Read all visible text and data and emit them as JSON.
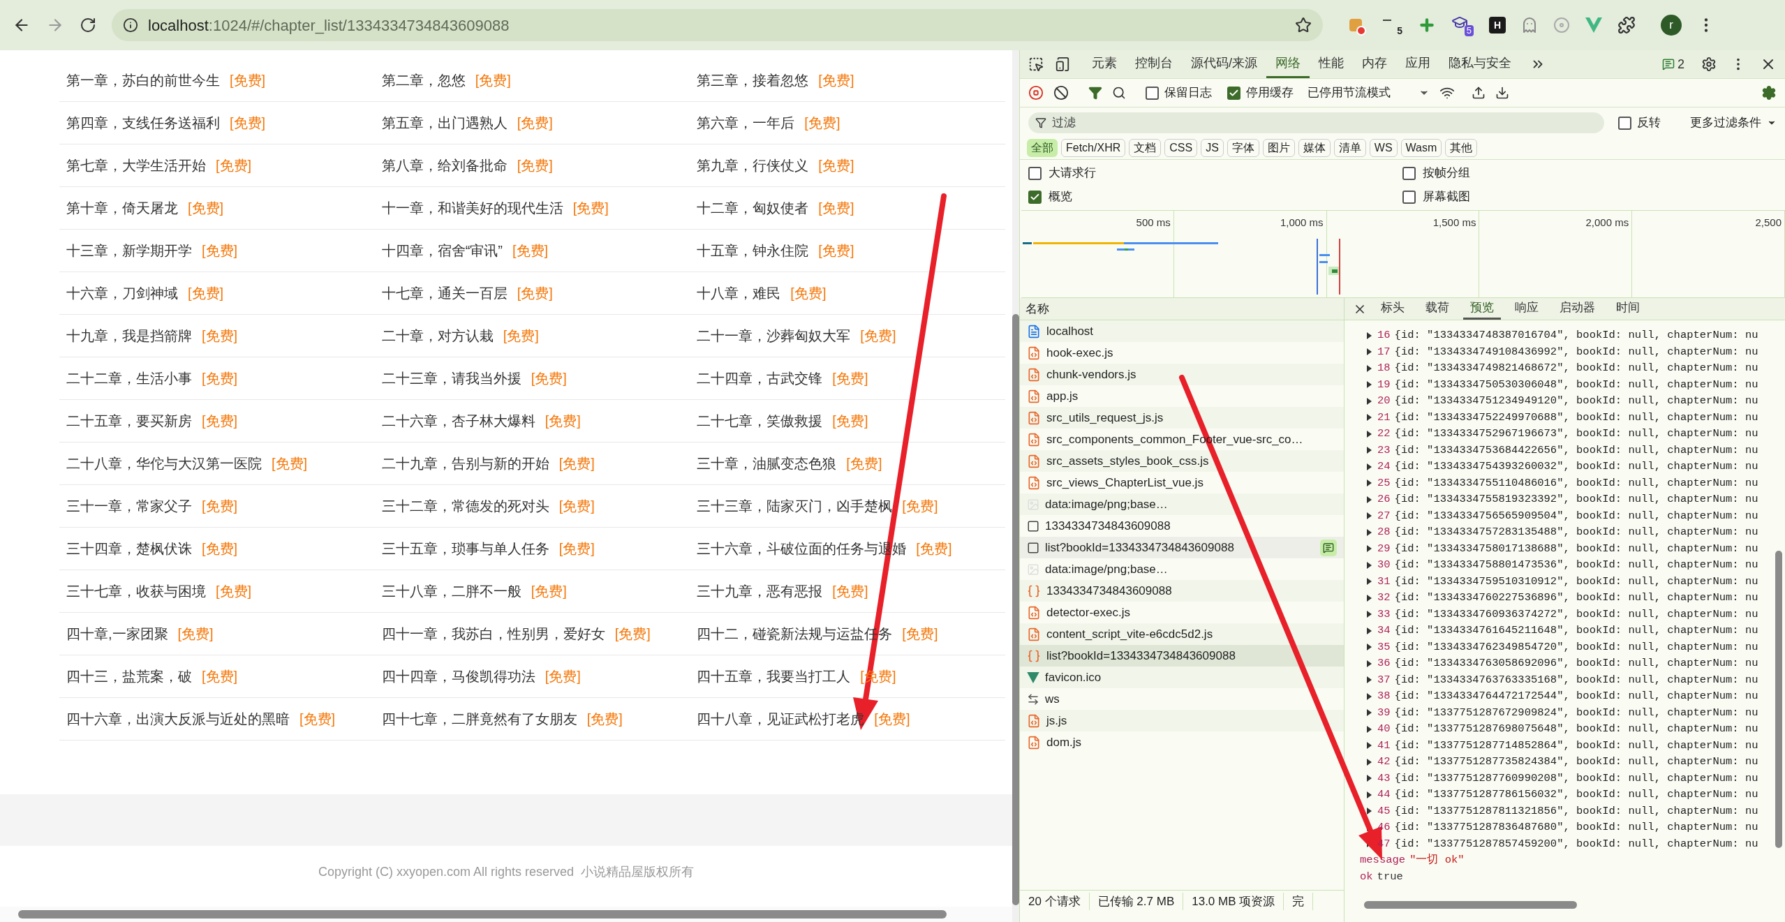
{
  "browser": {
    "url_host": "localhost",
    "url_rest": ":1024/#/chapter_list/1334334734843609088",
    "extensions": [
      {
        "kind": "block"
      },
      {
        "kind": "count",
        "badge": "5"
      },
      {
        "kind": "plus"
      },
      {
        "kind": "hat",
        "badge": "5"
      },
      {
        "kind": "letter",
        "badge": "H"
      },
      {
        "kind": "ghost"
      },
      {
        "kind": "disc"
      },
      {
        "kind": "vee"
      },
      {
        "kind": "puzzle"
      }
    ],
    "avatar": "r"
  },
  "chapters": [
    {
      "title": "第一章，苏白的前世今生",
      "tag": "[免费]"
    },
    {
      "title": "第二章，忽悠",
      "tag": "[免费]"
    },
    {
      "title": "第三章，接着忽悠",
      "tag": "[免费]"
    },
    {
      "title": "第四章，支线任务送福利",
      "tag": "[免费]"
    },
    {
      "title": "第五章，出门遇熟人",
      "tag": "[免费]"
    },
    {
      "title": "第六章，一年后",
      "tag": "[免费]"
    },
    {
      "title": "第七章，大学生活开始",
      "tag": "[免费]"
    },
    {
      "title": "第八章，给刘备批命",
      "tag": "[免费]"
    },
    {
      "title": "第九章，行侠仗义",
      "tag": "[免费]"
    },
    {
      "title": "第十章，倚天屠龙",
      "tag": "[免费]"
    },
    {
      "title": "十一章，和谐美好的现代生活",
      "tag": "[免费]"
    },
    {
      "title": "十二章，匈奴使者",
      "tag": "[免费]"
    },
    {
      "title": "十三章，新学期开学",
      "tag": "[免费]"
    },
    {
      "title": "十四章，宿舍“审讯”",
      "tag": "[免费]"
    },
    {
      "title": "十五章，钟永住院",
      "tag": "[免费]"
    },
    {
      "title": "十六章，刀剑神域",
      "tag": "[免费]"
    },
    {
      "title": "十七章，通关一百层",
      "tag": "[免费]"
    },
    {
      "title": "十八章，难民",
      "tag": "[免费]"
    },
    {
      "title": "十九章，我是挡箭牌",
      "tag": "[免费]"
    },
    {
      "title": "二十章，对方认栽",
      "tag": "[免费]"
    },
    {
      "title": "二十一章，沙葬匈奴大军",
      "tag": "[免费]"
    },
    {
      "title": "二十二章，生活小事",
      "tag": "[免费]"
    },
    {
      "title": "二十三章，请我当外援",
      "tag": "[免费]"
    },
    {
      "title": "二十四章，古武交锋",
      "tag": "[免费]"
    },
    {
      "title": "二十五章，要买新房",
      "tag": "[免费]"
    },
    {
      "title": "二十六章，杏子林大爆料",
      "tag": "[免费]"
    },
    {
      "title": "二十七章，笑傲救援",
      "tag": "[免费]"
    },
    {
      "title": "二十八章，华佗与大汉第一医院",
      "tag": "[免费]"
    },
    {
      "title": "二十九章，告别与新的开始",
      "tag": "[免费]"
    },
    {
      "title": "三十章，油腻变态色狼",
      "tag": "[免费]"
    },
    {
      "title": "三十一章，常家父子",
      "tag": "[免费]"
    },
    {
      "title": "三十二章，常德发的死对头",
      "tag": "[免费]"
    },
    {
      "title": "三十三章，陆家灭门，凶手楚枫",
      "tag": "[免费]"
    },
    {
      "title": "三十四章，楚枫伏诛",
      "tag": "[免费]"
    },
    {
      "title": "三十五章，琐事与单人任务",
      "tag": "[免费]"
    },
    {
      "title": "三十六章，斗破位面的任务与退婚",
      "tag": "[免费]"
    },
    {
      "title": "三十七章，收获与困境",
      "tag": "[免费]"
    },
    {
      "title": "三十八章，二胖不一般",
      "tag": "[免费]"
    },
    {
      "title": "三十九章，恶有恶报",
      "tag": "[免费]"
    },
    {
      "title": "四十章,一家团聚",
      "tag": "[免费]"
    },
    {
      "title": "四十一章，我苏白，性别男，爱好女",
      "tag": "[免费]"
    },
    {
      "title": "四十二，碰瓷新法规与运盐任务",
      "tag": "[免费]"
    },
    {
      "title": "四十三，盐荒案，破",
      "tag": "[免费]"
    },
    {
      "title": "四十四章，马俊凯得功法",
      "tag": "[免费]"
    },
    {
      "title": "四十五章，我要当打工人",
      "tag": "[免费]"
    },
    {
      "title": "四十六章，出演大反派与近处的黑暗",
      "tag": "[免费]"
    },
    {
      "title": "四十七章，二胖竟然有了女朋友",
      "tag": "[免费]"
    },
    {
      "title": "四十八章，见证武松打老虎",
      "tag": "[免费]"
    }
  ],
  "footer": "Copyright (C) xxyopen.com All rights reserved  小说精品屋版权所有",
  "devtools": {
    "tabs": [
      {
        "label": "元素",
        "selected": false
      },
      {
        "label": "控制台",
        "selected": false
      },
      {
        "label": "源代码/来源",
        "selected": false
      },
      {
        "label": "网络",
        "selected": true
      },
      {
        "label": "性能",
        "selected": false
      },
      {
        "label": "内存",
        "selected": false
      },
      {
        "label": "应用",
        "selected": false
      },
      {
        "label": "隐私与安全",
        "selected": false
      }
    ],
    "issues": "2",
    "preserve_log": {
      "label": "保留日志",
      "checked": false
    },
    "disable_cache": {
      "label": "停用缓存",
      "checked": true
    },
    "throttle": "已停用节流模式",
    "filter": {
      "placeholder": "过滤"
    },
    "invert": {
      "label": "反转",
      "checked": false
    },
    "more_filters": "更多过滤条件",
    "type_filters": [
      {
        "label": "全部",
        "selected": true
      },
      {
        "label": "Fetch/XHR",
        "selected": false
      },
      {
        "label": "文档",
        "selected": false
      },
      {
        "label": "CSS",
        "selected": false
      },
      {
        "label": "JS",
        "selected": false
      },
      {
        "label": "字体",
        "selected": false
      },
      {
        "label": "图片",
        "selected": false
      },
      {
        "label": "媒体",
        "selected": false
      },
      {
        "label": "清单",
        "selected": false
      },
      {
        "label": "WS",
        "selected": false
      },
      {
        "label": "Wasm",
        "selected": false
      },
      {
        "label": "其他",
        "selected": false
      }
    ],
    "options": [
      {
        "label": "大请求行",
        "checked": false
      },
      {
        "label": "按帧分组",
        "checked": false
      },
      {
        "label": "概览",
        "checked": true
      },
      {
        "label": "屏幕截图",
        "checked": false
      }
    ],
    "ticks": [
      "500 ms",
      "1,000 ms",
      "1,500 ms",
      "2,000 ms",
      "2,500"
    ],
    "name_header": "名称",
    "requests": [
      {
        "name": "localhost",
        "kind": "doc",
        "selected": false
      },
      {
        "name": "hook-exec.js",
        "kind": "script",
        "selected": false
      },
      {
        "name": "chunk-vendors.js",
        "kind": "script",
        "selected": false
      },
      {
        "name": "app.js",
        "kind": "script",
        "selected": false
      },
      {
        "name": "src_utils_request_js.js",
        "kind": "script",
        "selected": false
      },
      {
        "name": "src_components_common_Footer_vue-src_co…",
        "kind": "script",
        "selected": false
      },
      {
        "name": "src_assets_styles_book_css.js",
        "kind": "script",
        "selected": false
      },
      {
        "name": "src_views_ChapterList_vue.js",
        "kind": "script",
        "selected": false
      },
      {
        "name": "data:image/png;base…",
        "kind": "image",
        "selected": false
      },
      {
        "name": "1334334734843609088",
        "kind": "other",
        "selected": false
      },
      {
        "name": "list?bookId=1334334734843609088",
        "kind": "other",
        "selected": false,
        "hovered": true
      },
      {
        "name": "data:image/png;base…",
        "kind": "image",
        "selected": false
      },
      {
        "name": "1334334734843609088",
        "kind": "fetch",
        "selected": false
      },
      {
        "name": "detector-exec.js",
        "kind": "script",
        "selected": false
      },
      {
        "name": "content_script_vite-e6cdc5d2.js",
        "kind": "script",
        "selected": false
      },
      {
        "name": "list?bookId=1334334734843609088",
        "kind": "fetch",
        "selected": true
      },
      {
        "name": "favicon.ico",
        "kind": "favicon",
        "selected": false
      },
      {
        "name": "ws",
        "kind": "ws",
        "selected": false
      },
      {
        "name": "js.js",
        "kind": "script",
        "selected": false
      },
      {
        "name": "dom.js",
        "kind": "script",
        "selected": false
      }
    ],
    "status": [
      "20 个请求",
      "已传输 2.7 MB",
      "13.0 MB 项资源",
      "完"
    ],
    "detail_tabs": [
      {
        "label": "标头",
        "selected": false
      },
      {
        "label": "载荷",
        "selected": false
      },
      {
        "label": "预览",
        "selected": true
      },
      {
        "label": "响应",
        "selected": false
      },
      {
        "label": "启动器",
        "selected": false
      },
      {
        "label": "时间",
        "selected": false
      }
    ],
    "preview": [
      {
        "key": "16",
        "value": "{id: \"1334334748387016704\", bookId: null, chapterNum: nu"
      },
      {
        "key": "17",
        "value": "{id: \"1334334749108436992\", bookId: null, chapterNum: nu"
      },
      {
        "key": "18",
        "value": "{id: \"1334334749821468672\", bookId: null, chapterNum: nu"
      },
      {
        "key": "19",
        "value": "{id: \"1334334750530306048\", bookId: null, chapterNum: nu"
      },
      {
        "key": "20",
        "value": "{id: \"1334334751234949120\", bookId: null, chapterNum: nu"
      },
      {
        "key": "21",
        "value": "{id: \"1334334752249970688\", bookId: null, chapterNum: nu"
      },
      {
        "key": "22",
        "value": "{id: \"1334334752967196673\", bookId: null, chapterNum: nu"
      },
      {
        "key": "23",
        "value": "{id: \"1334334753684422656\", bookId: null, chapterNum: nu"
      },
      {
        "key": "24",
        "value": "{id: \"1334334754393260032\", bookId: null, chapterNum: nu"
      },
      {
        "key": "25",
        "value": "{id: \"1334334755110486016\", bookId: null, chapterNum: nu"
      },
      {
        "key": "26",
        "value": "{id: \"1334334755819323392\", bookId: null, chapterNum: nu"
      },
      {
        "key": "27",
        "value": "{id: \"1334334756565909504\", bookId: null, chapterNum: nu"
      },
      {
        "key": "28",
        "value": "{id: \"1334334757283135488\", bookId: null, chapterNum: nu"
      },
      {
        "key": "29",
        "value": "{id: \"1334334758017138688\", bookId: null, chapterNum: nu"
      },
      {
        "key": "30",
        "value": "{id: \"1334334758801473536\", bookId: null, chapterNum: nu"
      },
      {
        "key": "31",
        "value": "{id: \"1334334759510310912\", bookId: null, chapterNum: nu"
      },
      {
        "key": "32",
        "value": "{id: \"1334334760227536896\", bookId: null, chapterNum: nu"
      },
      {
        "key": "33",
        "value": "{id: \"1334334760936374272\", bookId: null, chapterNum: nu"
      },
      {
        "key": "34",
        "value": "{id: \"1334334761645211648\", bookId: null, chapterNum: nu"
      },
      {
        "key": "35",
        "value": "{id: \"1334334762349854720\", bookId: null, chapterNum: nu"
      },
      {
        "key": "36",
        "value": "{id: \"1334334763058692096\", bookId: null, chapterNum: nu"
      },
      {
        "key": "37",
        "value": "{id: \"1334334763763335168\", bookId: null, chapterNum: nu"
      },
      {
        "key": "38",
        "value": "{id: \"1334334764472172544\", bookId: null, chapterNum: nu"
      },
      {
        "key": "39",
        "value": "{id: \"1337751287672909824\", bookId: null, chapterNum: nu"
      },
      {
        "key": "40",
        "value": "{id: \"1337751287698075648\", bookId: null, chapterNum: nu"
      },
      {
        "key": "41",
        "value": "{id: \"1337751287714852864\", bookId: null, chapterNum: nu"
      },
      {
        "key": "42",
        "value": "{id: \"1337751287735824384\", bookId: null, chapterNum: nu"
      },
      {
        "key": "43",
        "value": "{id: \"1337751287760990208\", bookId: null, chapterNum: nu"
      },
      {
        "key": "44",
        "value": "{id: \"1337751287786156032\", bookId: null, chapterNum: nu"
      },
      {
        "key": "45",
        "value": "{id: \"1337751287811321856\", bookId: null, chapterNum: nu"
      },
      {
        "key": "46",
        "value": "{id: \"1337751287836487680\", bookId: null, chapterNum: nu"
      },
      {
        "key": "47",
        "value": "{id: \"1337751287857459200\", bookId: null, chapterNum: nu"
      }
    ],
    "message": {
      "key": "message",
      "value": "\"一切 ok\""
    },
    "ok": {
      "key": "ok",
      "value": "true"
    }
  }
}
